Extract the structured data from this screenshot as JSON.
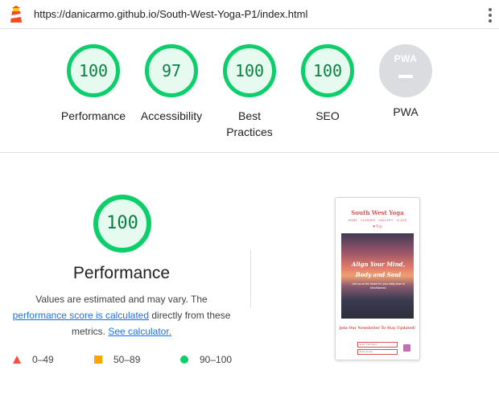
{
  "browser": {
    "url": "https://danicarmo.github.io/South-West-Yoga-P1/index.html",
    "icons": [
      "lighthouse-logo-icon",
      "kebab-menu-icon"
    ]
  },
  "gauges": [
    {
      "score": "100",
      "label": "Performance"
    },
    {
      "score": "97",
      "label": "Accessibility"
    },
    {
      "score": "100",
      "label": "Best Practices"
    },
    {
      "score": "100",
      "label": "SEO"
    },
    {
      "badge": "PWA",
      "label": "PWA"
    }
  ],
  "performance": {
    "score": "100",
    "title": "Performance",
    "desc_prefix": "Values are estimated and may vary. The ",
    "score_link": "performance score is calculated",
    "desc_middle": " directly from these metrics. ",
    "calc_link": "See calculator."
  },
  "legend": [
    {
      "range": "0–49",
      "color": "#ff4e42",
      "shape": "triangle"
    },
    {
      "range": "50–89",
      "color": "#ffa400",
      "shape": "square"
    },
    {
      "range": "90–100",
      "color": "#0cce6b",
      "shape": "circle"
    }
  ],
  "screenshot": {
    "title": "South West Yoga",
    "nav": "HOME · CLASSES · GALLERY · CLASS",
    "social": "♥ f ◎",
    "hero_heading": "Align Your Mind, Body and Soul",
    "hero_sub": "Join us on the beach for your daily dose of Mindfulness!",
    "newsletter": "Join Our Newsletter To Stay Updated!",
    "name_placeholder": "Enter Full Name",
    "email_placeholder": "Enter Email"
  },
  "colors": {
    "pass": "#0cce6b",
    "average": "#ffa400",
    "fail": "#ff4e42",
    "link": "#1a73e8"
  }
}
